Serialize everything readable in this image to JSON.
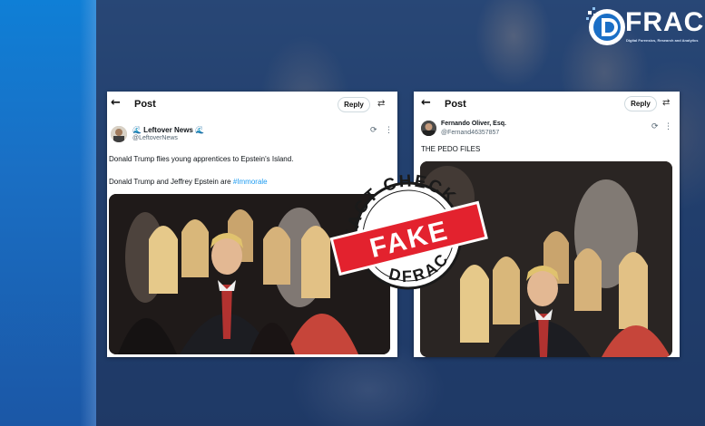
{
  "logo": {
    "text": "FRAC",
    "tagline": "Digital Forensics, Research and Analytics Centre"
  },
  "stamp": {
    "top_text": "FACT CHECK",
    "label": "FAKE",
    "bottom_text": "DFRAC"
  },
  "tweet1": {
    "header_title": "Post",
    "reply_label": "Reply",
    "display_name": "🌊 Leftover News 🌊",
    "handle": "@LeftoverNews",
    "line1": "Donald Trump flies young apprentices to Epstein's Island.",
    "line2_prefix": "Donald Trump and Jeffrey Epstein are ",
    "hashtag": "#Immorale"
  },
  "tweet2": {
    "header_title": "Post",
    "reply_label": "Reply",
    "display_name": "Fernando Oliver, Esq.",
    "handle": "@Fernand46357857",
    "text": "THE PEDO FILES"
  },
  "colors": {
    "link": "#1d9bf0",
    "stamp_red": "#e3222e",
    "brand_blue": "#1b6fc6"
  }
}
